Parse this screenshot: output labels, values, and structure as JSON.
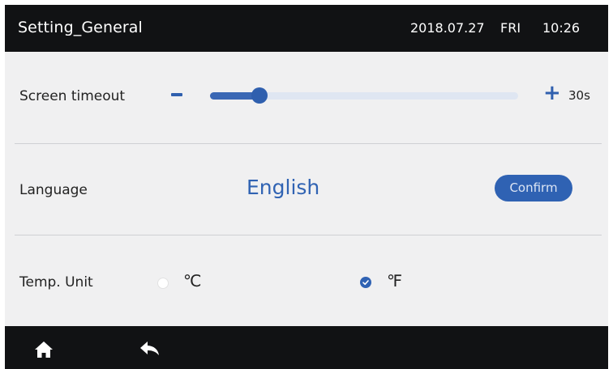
{
  "header": {
    "title": "Setting_General",
    "date": "2018.07.27",
    "day": "FRI",
    "time": "10:26"
  },
  "screen_timeout": {
    "label": "Screen timeout",
    "value_text": "30s",
    "level_fraction": 0.16
  },
  "language": {
    "label": "Language",
    "value": "English",
    "confirm_label": "Confirm"
  },
  "temp_unit": {
    "label": "Temp. Unit",
    "options": [
      {
        "label": "℃",
        "selected": false
      },
      {
        "label": "℉",
        "selected": true
      }
    ]
  },
  "footer": {
    "icons": [
      "home-icon",
      "back-icon"
    ]
  },
  "colors": {
    "accent": "#2f62b3",
    "header_bg": "#111214",
    "panel_bg": "#f0f0f1"
  }
}
